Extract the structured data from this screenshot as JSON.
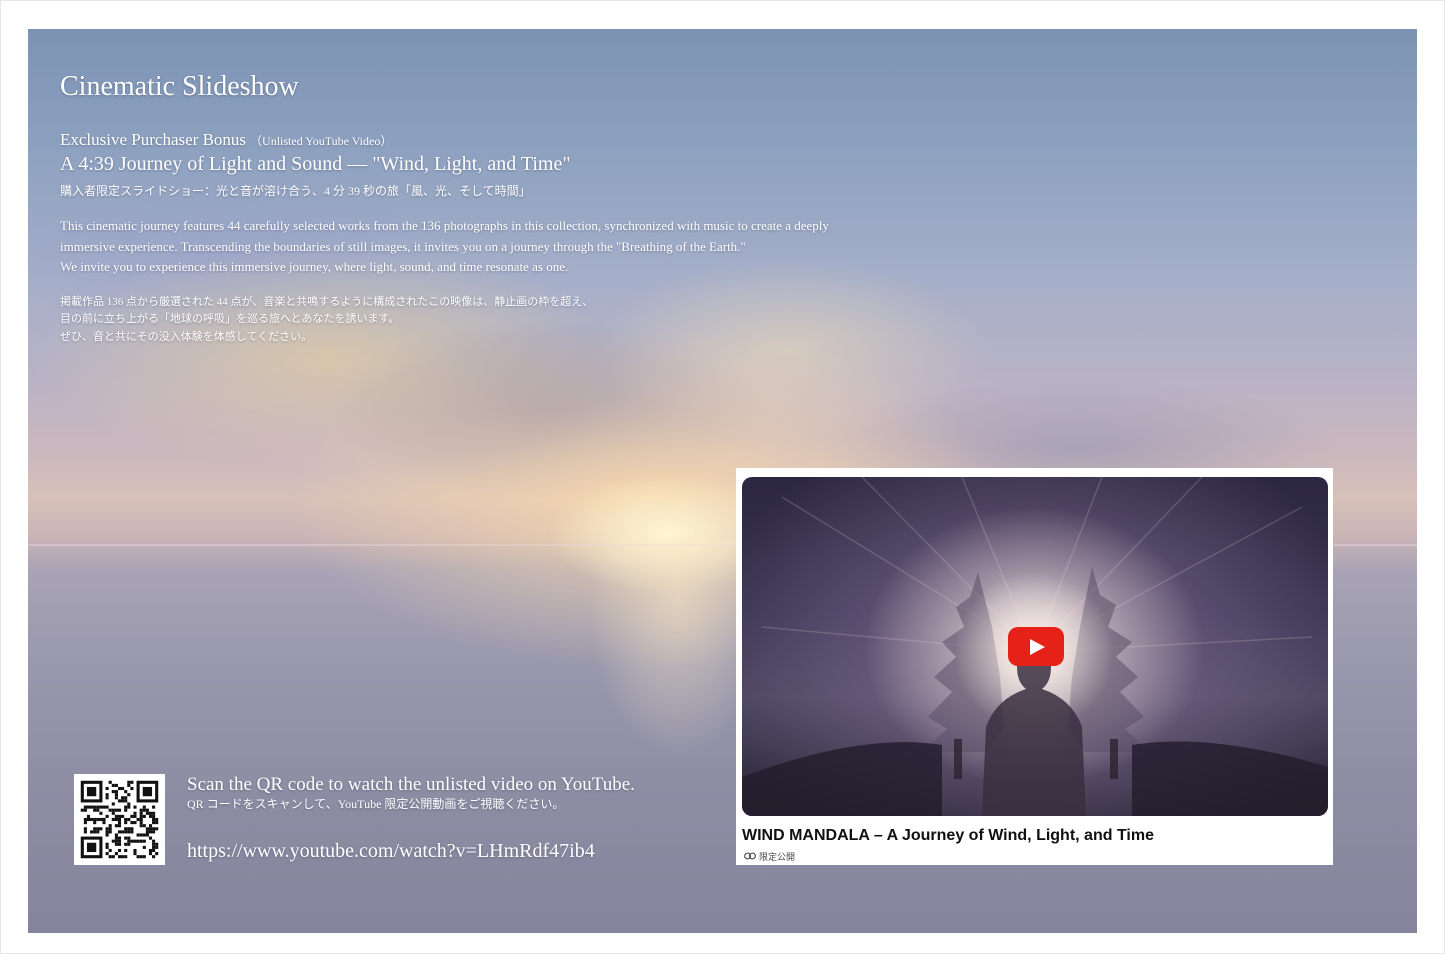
{
  "slide": {
    "title": "Cinematic Slideshow",
    "bonus_label": "Exclusive Purchaser Bonus",
    "bonus_note": "（Unlisted YouTube Video）",
    "subtitle": "A 4:39 Journey of Light and Sound — \"Wind, Light, and Time\"",
    "subtitle_ja": "購入者限定スライドショー：光と音が溶け合う、4 分 39 秒の旅「風、光、そして時間」",
    "description_en": [
      "This cinematic journey features 44 carefully selected works from the 136 photographs in this collection, synchronized with music to create a deeply",
      "immersive experience. Transcending the boundaries of still images, it invites you on a journey through the \"Breathing of the Earth.\"",
      "We invite you to experience this immersive journey, where light, sound, and time resonate as one."
    ],
    "description_ja": [
      "掲載作品 136 点から厳選された 44 点が、音楽と共鳴するように構成されたこの映像は、静止画の枠を超え、",
      "目の前に立ち上がる「地球の呼吸」を巡る旅へとあなたを誘います。",
      "ぜひ、音と共にその没入体験を体感してください。"
    ]
  },
  "qr": {
    "scan_en": "Scan the QR code to watch the unlisted video on YouTube.",
    "scan_ja": "QR コードをスキャンして、YouTube 限定公開動画をご視聴ください。",
    "url": "https://www.youtube.com/watch?v=LHmRdf47ib4"
  },
  "video": {
    "title": "WIND MANDALA – A Journey of Wind, Light, and Time",
    "visibility": "限定公開",
    "icon": "link-icon",
    "play_color": "#e62117"
  }
}
